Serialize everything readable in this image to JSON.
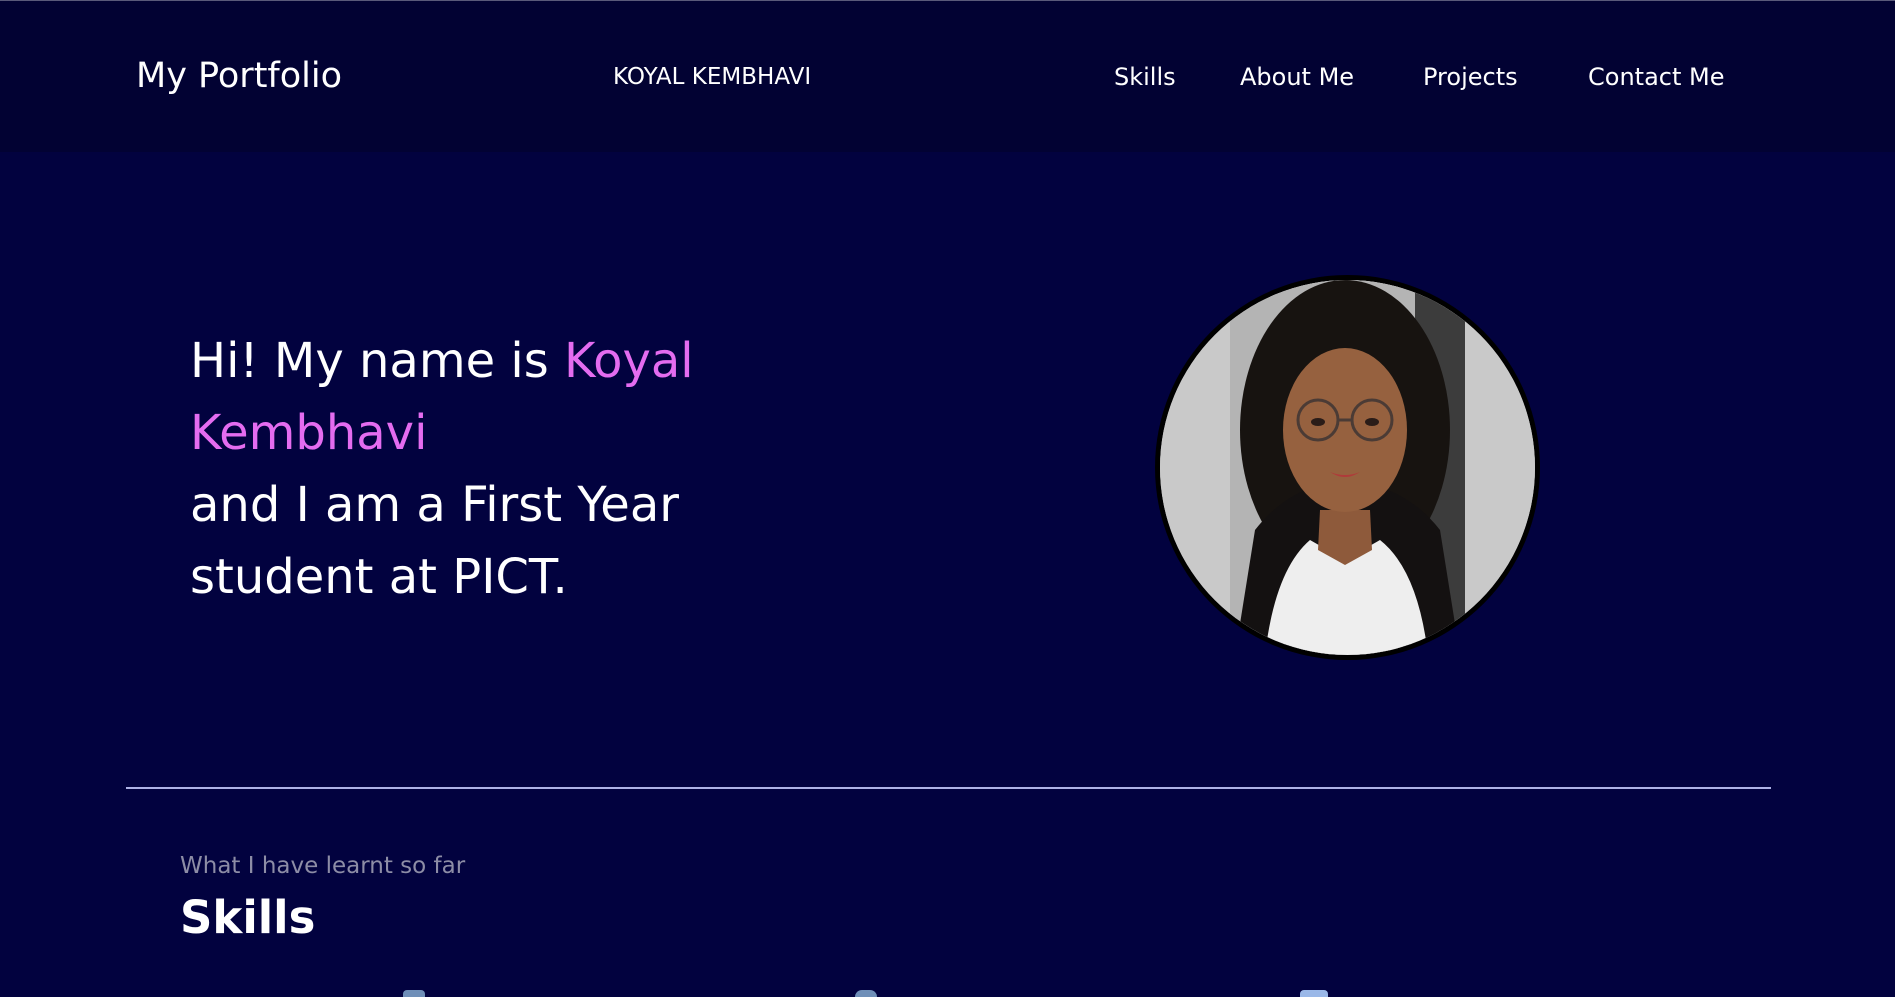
{
  "navbar": {
    "brand": "My Portfolio",
    "owner_name": "KOYAL KEMBHAVI",
    "links": [
      {
        "label": "Skills"
      },
      {
        "label": "About Me"
      },
      {
        "label": "Projects"
      },
      {
        "label": "Contact Me"
      }
    ]
  },
  "hero": {
    "intro_prefix": "Hi! My name is ",
    "name": "Koyal Kembhavi",
    "intro_suffix": "and I am a First Year student at PICT.",
    "accent_color": "#e46cf0"
  },
  "skills": {
    "subtitle": "What I have learnt so far",
    "title": "Skills"
  },
  "colors": {
    "background": "#02023f",
    "navbar": "#020233",
    "divider": "#aeb2e6"
  }
}
